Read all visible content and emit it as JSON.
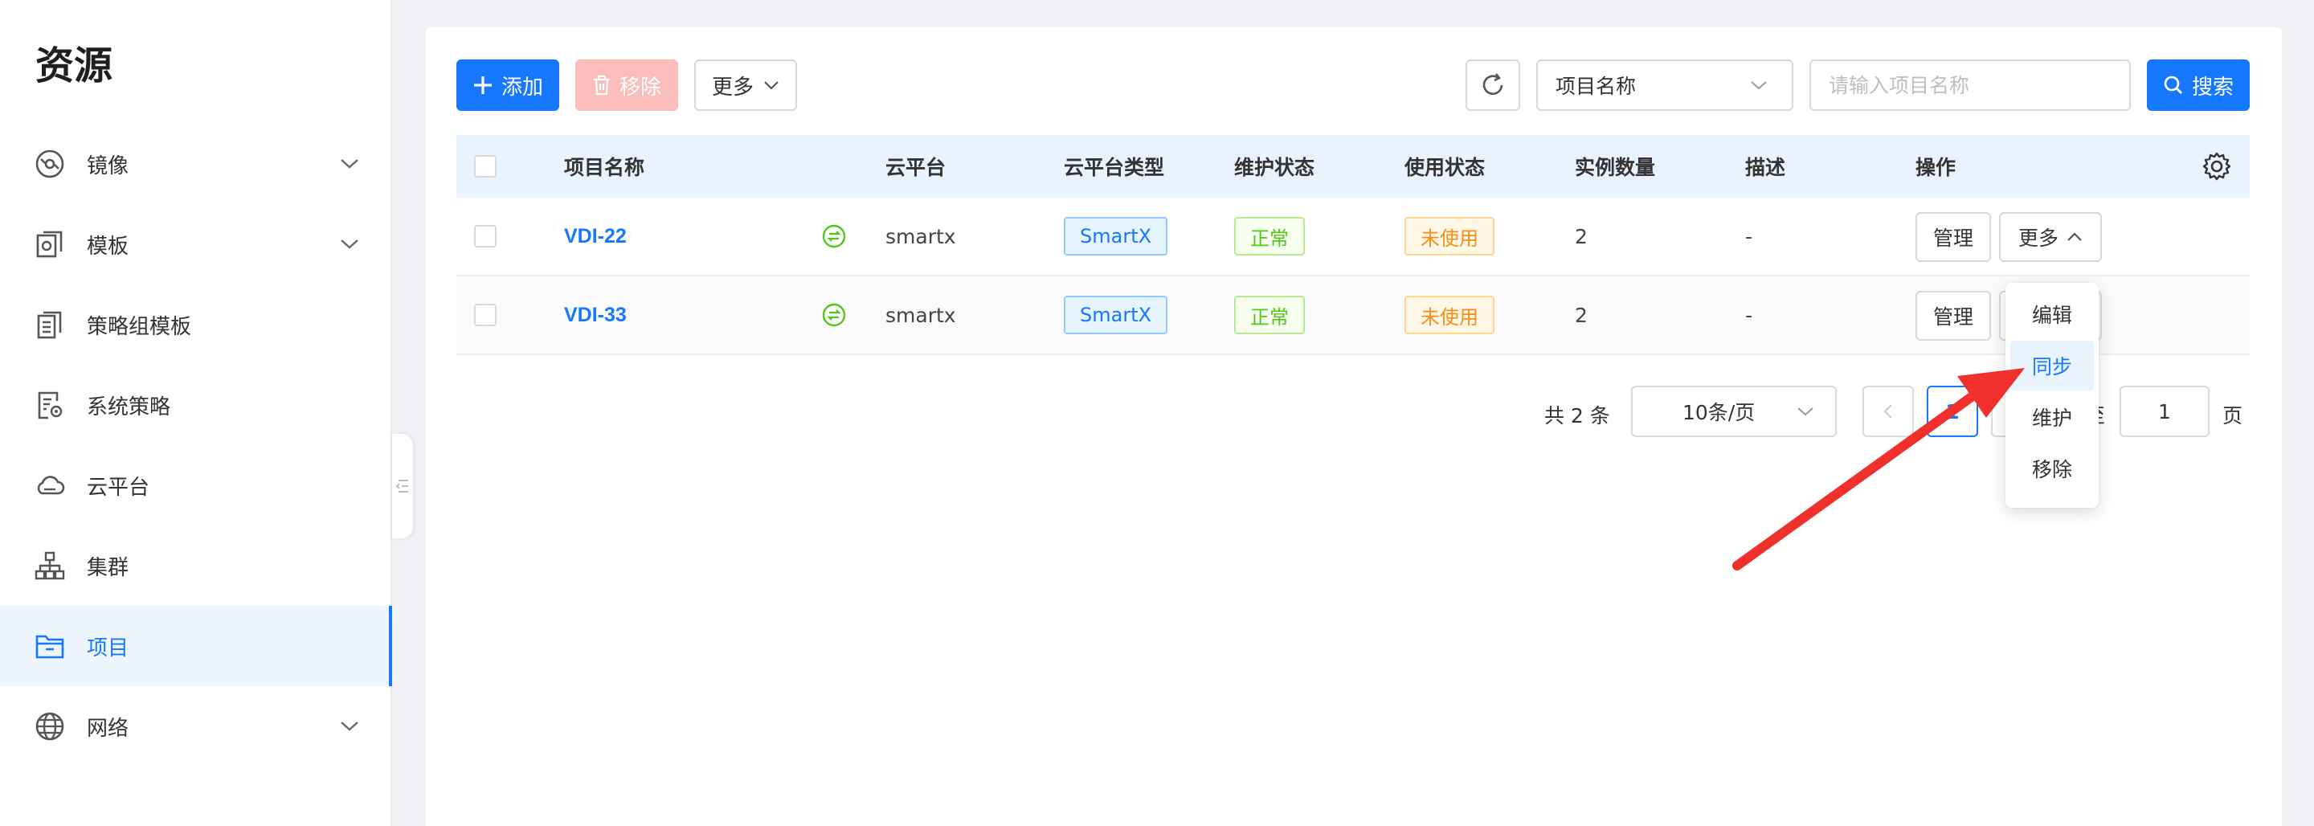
{
  "sidebar": {
    "title": "资源",
    "items": [
      {
        "label": "镜像",
        "icon": "image-disc-icon",
        "expandable": true
      },
      {
        "label": "模板",
        "icon": "template-icon",
        "expandable": true
      },
      {
        "label": "策略组模板",
        "icon": "policy-template-icon",
        "expandable": false
      },
      {
        "label": "系统策略",
        "icon": "system-policy-icon",
        "expandable": false
      },
      {
        "label": "云平台",
        "icon": "cloud-icon",
        "expandable": false
      },
      {
        "label": "集群",
        "icon": "cluster-icon",
        "expandable": false
      },
      {
        "label": "项目",
        "icon": "folder-icon",
        "expandable": false,
        "active": true
      },
      {
        "label": "网络",
        "icon": "globe-icon",
        "expandable": true
      }
    ]
  },
  "toolbar": {
    "add_label": "添加",
    "remove_label": "移除",
    "more_label": "更多",
    "search_field_select": "项目名称",
    "search_placeholder": "请输入项目名称",
    "search_label": "搜索"
  },
  "table": {
    "columns": [
      "项目名称",
      "云平台",
      "云平台类型",
      "维护状态",
      "使用状态",
      "实例数量",
      "描述",
      "操作"
    ],
    "rows": [
      {
        "name": "VDI-22",
        "platform": "smartx",
        "platform_type": "SmartX",
        "maintenance": "正常",
        "usage": "未使用",
        "instances": "2",
        "description": "-",
        "manage": "管理",
        "more": "更多"
      },
      {
        "name": "VDI-33",
        "platform": "smartx",
        "platform_type": "SmartX",
        "maintenance": "正常",
        "usage": "未使用",
        "instances": "2",
        "description": "-",
        "manage": "管理",
        "more": "更多"
      }
    ]
  },
  "pagination": {
    "total_text": "共 2 条",
    "page_size": "10条/页",
    "current_page": "1",
    "goto_prefix": "跳至",
    "goto_value": "1",
    "goto_suffix": "页"
  },
  "dropdown_menu": {
    "items": [
      "编辑",
      "同步",
      "维护",
      "移除"
    ],
    "highlighted": "同步"
  },
  "colors": {
    "primary": "#1677ff",
    "annotation_arrow": "#f0302a"
  }
}
